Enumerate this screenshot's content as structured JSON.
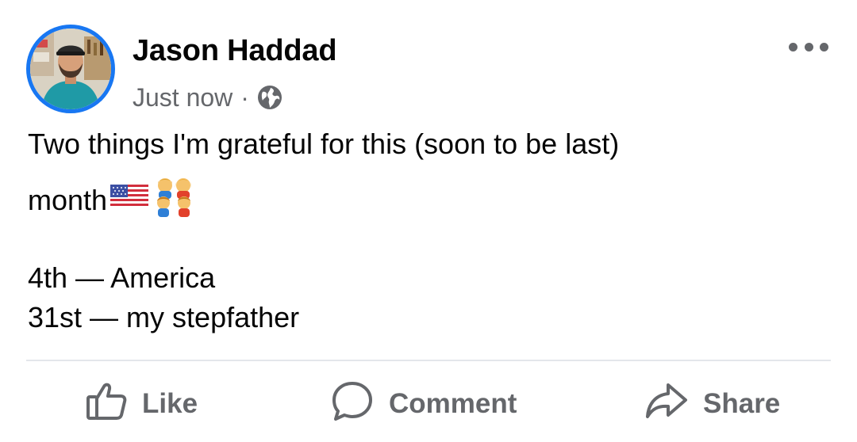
{
  "post": {
    "author": "Jason Haddad",
    "timestamp": "Just now",
    "separator": "·",
    "privacy_icon": "globe-icon",
    "more_icon": "more-options-icon",
    "text_lines": [
      "Two things I'm grateful for this (soon to be last)",
      "month",
      "4th — America",
      "31st — my stepfather"
    ],
    "emojis": [
      "us-flag-emoji",
      "family-emoji"
    ]
  },
  "actions": {
    "like_label": "Like",
    "comment_label": "Comment",
    "share_label": "Share"
  },
  "colors": {
    "accent": "#1877f2",
    "secondary_text": "#65676b",
    "primary_text": "#050505",
    "divider": "#e4e6eb"
  }
}
